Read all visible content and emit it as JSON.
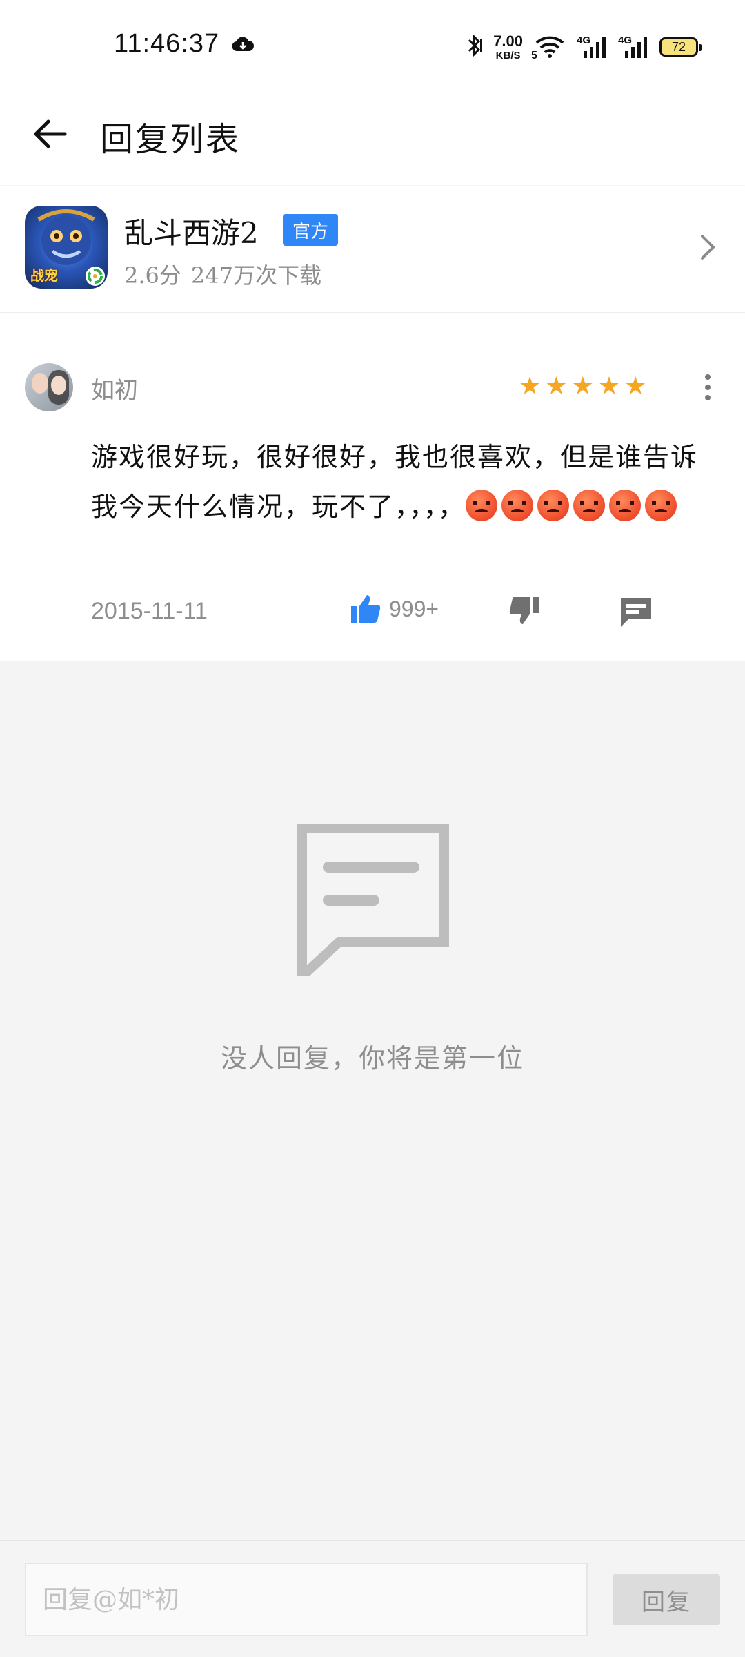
{
  "status_bar": {
    "time": "11:46:37",
    "network_speed_value": "7.00",
    "network_speed_unit": "KB/S",
    "wifi_label": "5",
    "signal1_label": "4G",
    "signal2_label": "4G",
    "battery": "72",
    "icons": [
      "cloud-download-icon",
      "bluetooth-icon",
      "wifi-icon",
      "signal-icon",
      "signal-icon",
      "battery-icon"
    ]
  },
  "header": {
    "title": "回复列表",
    "back_icon": "arrow-left-icon"
  },
  "app": {
    "name": "乱斗西游2",
    "badge": "官方",
    "rating": "2.6分",
    "downloads": "247万次下载",
    "icon_badge": "战宠",
    "chevron_icon": "chevron-right-icon"
  },
  "comment": {
    "username": "如初",
    "stars": 5,
    "text": "游戏很好玩，很好很好，我也很喜欢，但是谁告诉我今天什么情况，玩不了，，，，",
    "emoji_count": 6,
    "emoji_icon": "angry-face-icon",
    "date": "2015-11-11",
    "likes": "999+",
    "star_color": "#f5a623",
    "like_color": "#2f86f6"
  },
  "empty_state": {
    "message": "没人回复，你将是第一位",
    "icon": "comment-bubble-icon"
  },
  "reply_bar": {
    "placeholder": "回复@如*初",
    "submit_label": "回复"
  }
}
